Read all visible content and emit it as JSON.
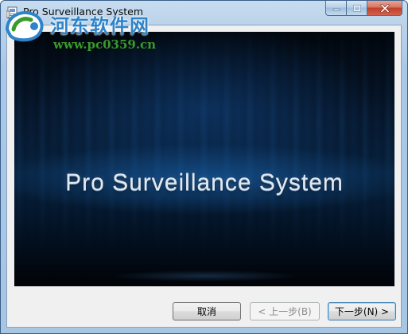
{
  "window": {
    "title": "Pro Surveillance System",
    "icons": {
      "app": "installer-icon",
      "minimize": "minimize-icon",
      "maximize": "maximize-icon",
      "close": "close-icon"
    }
  },
  "watermark": {
    "site_name": "河东软件网",
    "url": "www.pc0359.cn",
    "logo_icon": "watermark-logo-icon"
  },
  "splash": {
    "title": "Pro Surveillance System"
  },
  "buttons": {
    "cancel": "取消",
    "back": "< 上一步(B)",
    "next": "下一步(N) >"
  },
  "colors": {
    "titlebar": "#aac8e6",
    "close_button": "#c0412a",
    "splash_background": "#07203b",
    "watermark_blue": "#2f83c8",
    "watermark_green": "#3a9a2a"
  }
}
